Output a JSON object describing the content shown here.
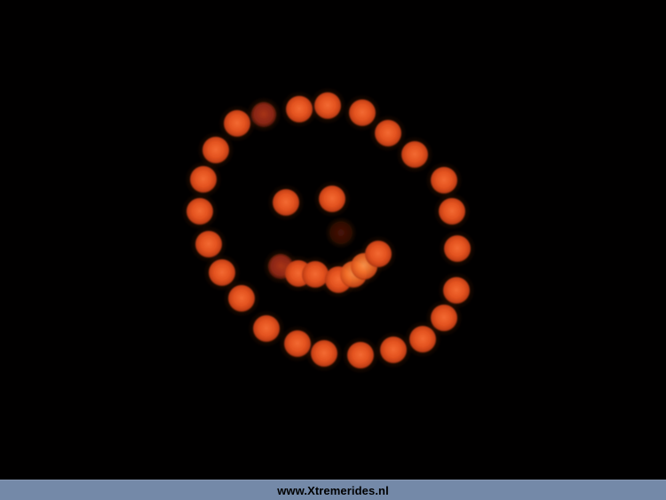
{
  "footer": {
    "site_link_text": "www.Xtremerides.nl",
    "bar_color": "#7489a8"
  },
  "photo": {
    "subject_icon": "smiley-face-bokeh-lights",
    "background_color": "#010000",
    "light_color": "#e8501f"
  }
}
